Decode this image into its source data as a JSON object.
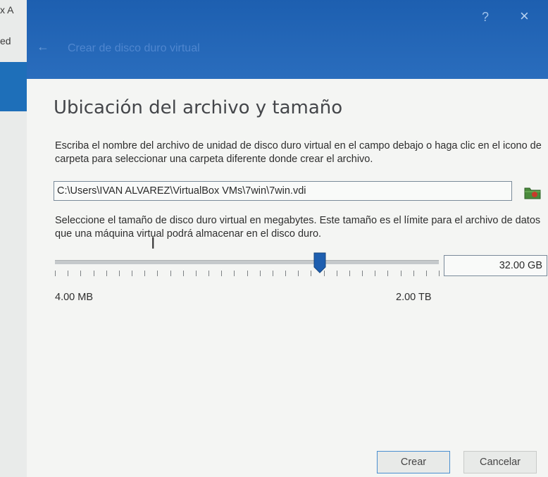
{
  "background_window": {
    "line1": "x A",
    "line2": "ed"
  },
  "titlebar": {
    "title": "Crear de disco duro virtual",
    "help_label": "?",
    "close_label": "×",
    "back_label": "←"
  },
  "section": {
    "heading": "Ubicación del archivo y tamaño",
    "location_instructions": "Escriba el nombre del archivo de unidad de disco duro virtual en el campo debajo o haga clic en el icono de carpeta para seleccionar una carpeta diferente donde crear el archivo.",
    "file_path": "C:\\Users\\IVAN ALVAREZ\\VirtualBox VMs\\7win\\7win.vdi",
    "size_instructions": "Seleccione el tamaño de disco duro virtual en megabytes. Este tamaño es el límite para el archivo de datos que una máquina virtual podrá almacenar en el disco duro.",
    "size_value": "32.00 GB",
    "slider_min_label": "4.00 MB",
    "slider_max_label": "2.00 TB",
    "slider_position_fraction": 0.69
  },
  "buttons": {
    "create": "Crear",
    "cancel": "Cancelar"
  },
  "colors": {
    "titlebar": "#1d5fb0",
    "accent": "#1e5fb0",
    "folder_icon": "#4a8a3c"
  }
}
